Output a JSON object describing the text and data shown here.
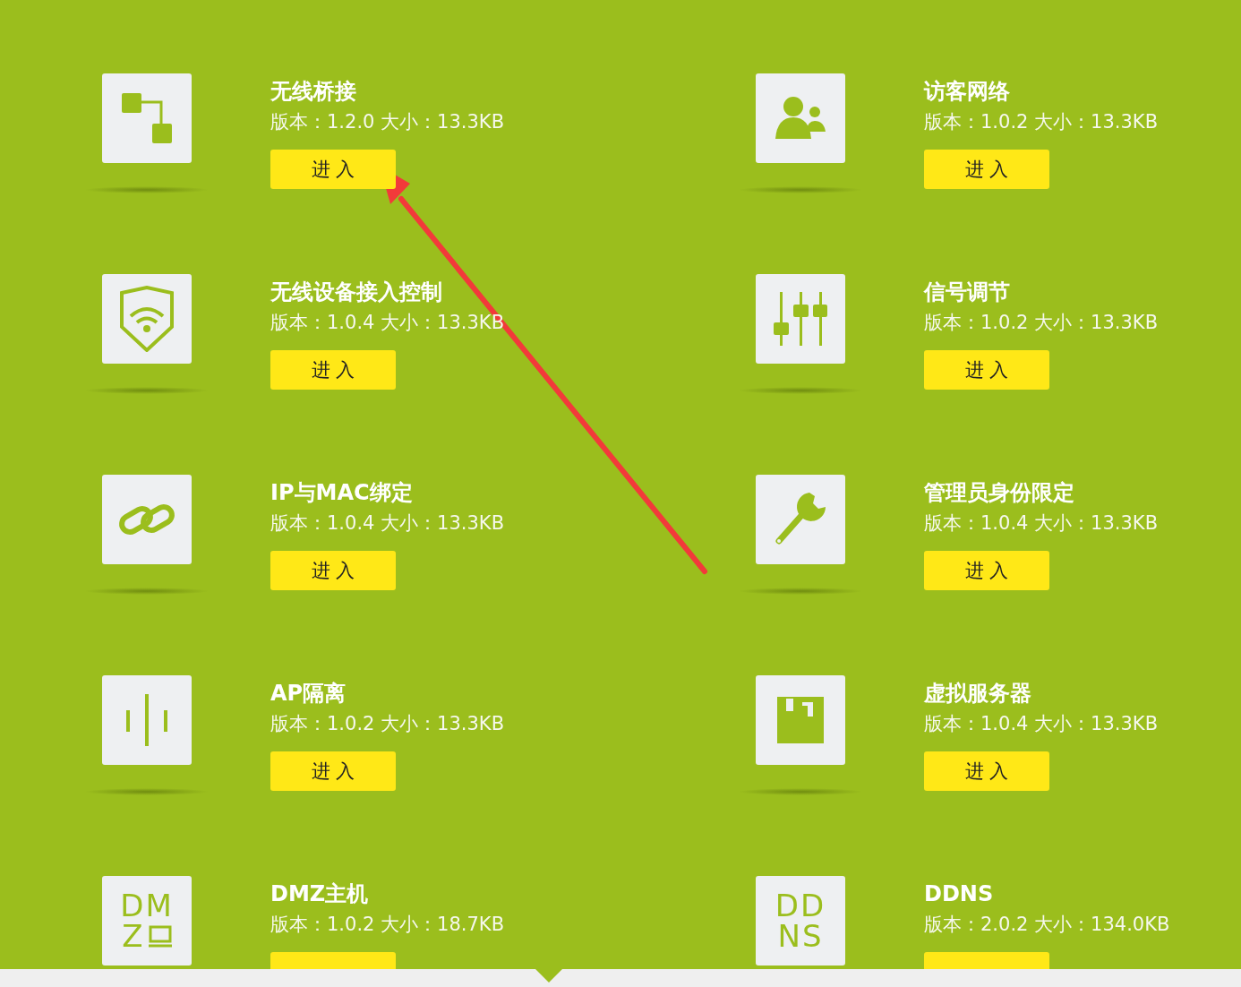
{
  "plugins": [
    {
      "name": "无线桥接",
      "info": "版本：1.2.0 大小：13.3KB",
      "icon": {
        "kind": "bridge"
      },
      "button": {
        "label": "进 入"
      }
    },
    {
      "name": "访客网络",
      "info": "版本：1.0.2 大小：13.3KB",
      "icon": {
        "kind": "guests"
      },
      "button": {
        "label": "进 入"
      }
    },
    {
      "name": "无线设备接入控制",
      "info": "版本：1.0.4 大小：13.3KB",
      "icon": {
        "kind": "shield-wifi"
      },
      "button": {
        "label": "进 入"
      }
    },
    {
      "name": "信号调节",
      "info": "版本：1.0.2 大小：13.3KB",
      "icon": {
        "kind": "sliders"
      },
      "button": {
        "label": "进 入"
      }
    },
    {
      "name": "IP与MAC绑定",
      "info": "版本：1.0.4 大小：13.3KB",
      "icon": {
        "kind": "link"
      },
      "button": {
        "label": "进 入"
      }
    },
    {
      "name": "管理员身份限定",
      "info": "版本：1.0.4 大小：13.3KB",
      "icon": {
        "kind": "wrench"
      },
      "button": {
        "label": "进 入"
      }
    },
    {
      "name": "AP隔离",
      "info": "版本：1.0.2 大小：13.3KB",
      "icon": {
        "kind": "bars"
      },
      "button": {
        "label": "进 入"
      }
    },
    {
      "name": "虚拟服务器",
      "info": "版本：1.0.4 大小：13.3KB",
      "icon": {
        "kind": "floppy"
      },
      "button": {
        "label": "进 入"
      }
    },
    {
      "name": "DMZ主机",
      "info": "版本：1.0.2 大小：18.7KB",
      "icon": {
        "kind": "text",
        "lines": [
          "DM",
          "Z"
        ],
        "computer": true
      }
    },
    {
      "name": "DDNS",
      "info": "版本：2.0.2 大小：134.0KB",
      "icon": {
        "kind": "text",
        "lines": [
          "DD",
          "NS"
        ],
        "computer": false
      }
    }
  ]
}
